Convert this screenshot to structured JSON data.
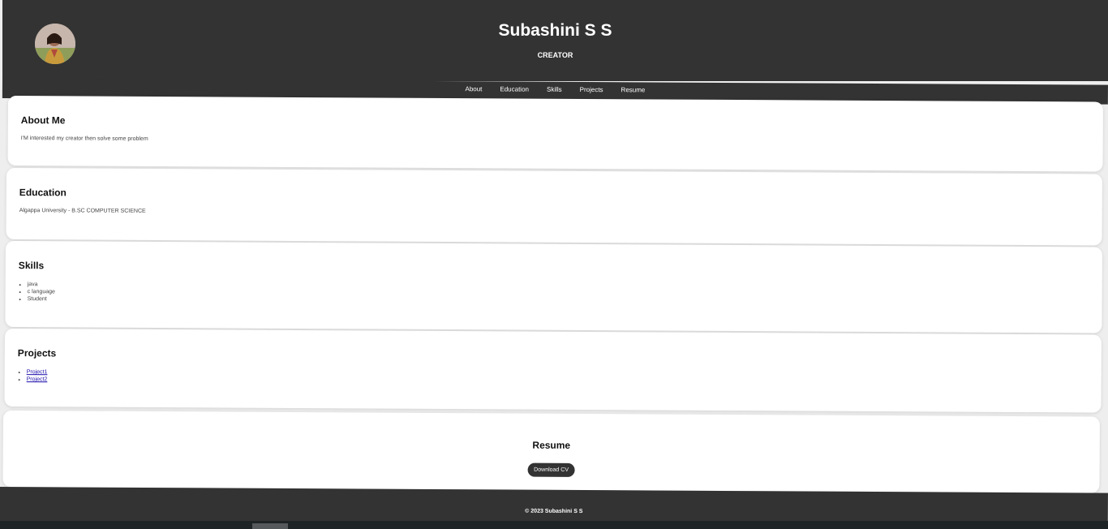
{
  "header": {
    "name": "Subashini S S",
    "role": "CREATOR"
  },
  "nav": {
    "items": [
      "About",
      "Education",
      "Skills",
      "Projects",
      "Resume"
    ]
  },
  "about": {
    "title": "About Me",
    "text": "I'M interested my creator then solve some problem"
  },
  "education": {
    "title": "Education",
    "text": "Algappa University - B.SC COMPUTER SCIENCE"
  },
  "skills": {
    "title": "Skills",
    "items": [
      "java",
      "c language",
      "Student"
    ]
  },
  "projects": {
    "title": "Projects",
    "items": [
      "Project1",
      "Project2"
    ]
  },
  "resume": {
    "title": "Resume",
    "button_label": "Download CV"
  },
  "footer": {
    "text": "© 2023 Subashini S S"
  },
  "colors": {
    "header_bg": "#333333",
    "page_bg": "#eeeeee",
    "card_bg": "#ffffff",
    "link": "#1a0dab"
  }
}
